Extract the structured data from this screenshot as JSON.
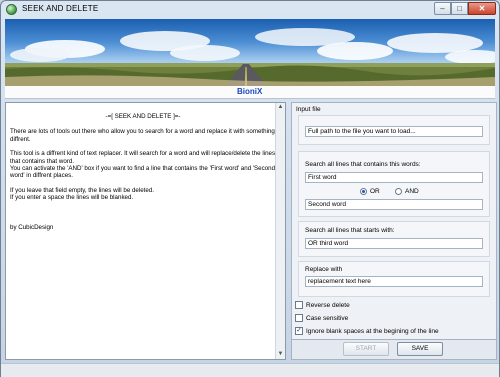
{
  "window": {
    "title": "SEEK AND DELETE",
    "app_icon": "green-circle-app-icon",
    "controls": {
      "minimize": "–",
      "maximize": "□",
      "close": "✕"
    }
  },
  "banner": {
    "brand": "BioniX"
  },
  "info_text": {
    "heading": "-=[ SEEK AND DELETE ]=-",
    "p1": "There are lots of tools out there who allow you to search for a word and replace it with something diffrent.",
    "p2": "This tool is a diffrent kind of text replacer. It will search for a word and will replace/delete the lines that contains that word.",
    "p3": "You can activate the 'AND' box if you want to find a line that contains the 'First word' and 'Second word' in diffrent places.",
    "p4": "If you leave that field empty, the lines will be deleted.",
    "p5": "If you enter a space the lines will be blanked.",
    "credit": "by CubicDesign"
  },
  "form": {
    "input_file_label": "Input file",
    "input_file_value": "Full path to the file you want to load...",
    "contains_label": "Search all lines that contains this words:",
    "first_word": "First word",
    "or_label": "OR",
    "and_label": "AND",
    "selected_operator": "OR",
    "second_word": "Second word",
    "starts_with_label": "Search all lines that starts with:",
    "starts_with_value": "OR   third word",
    "replace_label": "Replace with",
    "replace_value": "replacement text here",
    "reverse_delete_label": "Reverse delete",
    "reverse_delete_checked": false,
    "case_sensitive_label": "Case sensitive",
    "case_sensitive_checked": false,
    "ignore_blank_label": "Ignore blank spaces at the begining of the line",
    "ignore_blank_checked": true
  },
  "buttons": {
    "start": "START",
    "save": "SAVE"
  }
}
